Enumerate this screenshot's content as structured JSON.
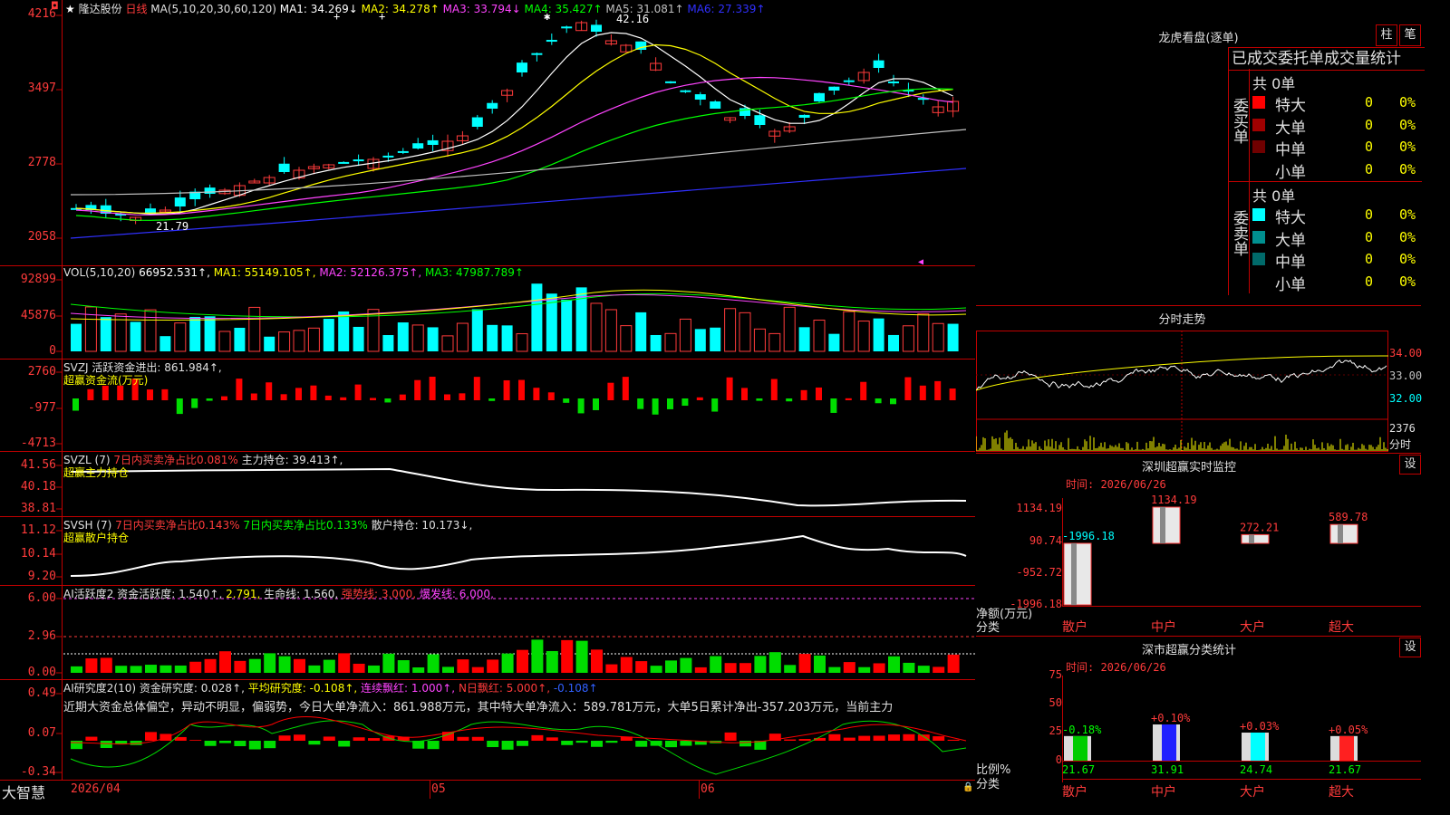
{
  "stock": {
    "star": "★",
    "name": "隆达股份",
    "period": "日线"
  },
  "ma_legend": {
    "params": "MA(5,10,20,30,60,120)",
    "items": [
      {
        "label": "MA1: 34.269↓",
        "color": "#ffffff"
      },
      {
        "label": "MA2: 34.278↑",
        "color": "#ffff00"
      },
      {
        "label": "MA3: 33.794↓",
        "color": "#ff44ff"
      },
      {
        "label": "MA4: 35.427↑",
        "color": "#00ff00"
      },
      {
        "label": "MA5: 31.081↑",
        "color": "#c0c0c0"
      },
      {
        "label": "MA6: 27.339↑",
        "color": "#3030ff"
      }
    ]
  },
  "price_axis": [
    "4216",
    "3497",
    "2778",
    "2058"
  ],
  "price_marks": {
    "high": "42.16",
    "low": "21.79"
  },
  "vol": {
    "axis": [
      "92899",
      "45876",
      "0"
    ],
    "title": "VOL(5,10,20)",
    "items": [
      {
        "label": "66952.531↑,",
        "color": "#ffffff"
      },
      {
        "label": "MA1: 55149.105↑,",
        "color": "#ffff00"
      },
      {
        "label": "MA2: 52126.375↑,",
        "color": "#ff44ff"
      },
      {
        "label": "MA3: 47987.789↑",
        "color": "#00ff00"
      }
    ]
  },
  "svzj": {
    "axis": [
      "2760",
      "-977",
      "-4713"
    ],
    "line1": "SVZJ  活跃资金进出: 861.984↑,",
    "line2": "超赢资金流(万元)"
  },
  "svzl": {
    "axis": [
      "41.56",
      "40.18",
      "38.81"
    ],
    "title": "SVZL (7)",
    "red": "7日内买卖净占比0.081%",
    "white": "主力持仓: 39.413↑,",
    "line2": "超赢主力持仓"
  },
  "svsh": {
    "axis": [
      "11.12",
      "10.14",
      "9.20"
    ],
    "title": "SVSH (7)",
    "red": "7日内买卖净占比0.143%",
    "green": "7日内买卖净占比0.133%",
    "white": "散户持仓: 10.173↓,",
    "line2": "超赢散户持仓"
  },
  "ai1": {
    "axis": [
      "6.00",
      "2.96",
      "0.00"
    ],
    "title": "AI活跃度2",
    "white": "资金活跃度: 1.540↑,",
    "yellow": "2.791,",
    "white2": "生命线: 1.560,",
    "red": "强势线: 3.000,",
    "magenta": "爆发线: 6.000,"
  },
  "ai2": {
    "axis": [
      "0.49",
      "0.07",
      "-0.34"
    ],
    "title": "AI研究度2(10)",
    "white": "资金研究度: 0.028↑,",
    "yellow": "平均研究度: -0.108↑,",
    "magenta": "连续飘红: 1.000↑,",
    "red": "N日飘红: 5.000↑,",
    "blue": "-0.108↑",
    "comment": "近期大资金总体偏空，异动不明显，偏弱势，今日大单净流入：861.988万元，其中特大单净流入：589.781万元，大单5日累计净出-357.203万元，当前主力"
  },
  "dates": {
    "brand": "大智慧",
    "d1": "2026/04",
    "d2": "05",
    "d3": "06"
  },
  "longhu": {
    "title": "龙虎看盘(逐单)",
    "btn1": "柱",
    "btn2": "笔",
    "tabs": "已成交委托单成交量统计",
    "buy": {
      "side": "委买单",
      "count": "共 0单",
      "rows": [
        {
          "name": "特大",
          "qty": "0",
          "pct": "0%",
          "color": "#ff0000"
        },
        {
          "name": "大单",
          "qty": "0",
          "pct": "0%",
          "color": "#a00000"
        },
        {
          "name": "中单",
          "qty": "0",
          "pct": "0%",
          "color": "#700000"
        },
        {
          "name": "小单",
          "qty": "0",
          "pct": "0%",
          "color": ""
        }
      ]
    },
    "sell": {
      "side": "委卖单",
      "count": "共 0单",
      "rows": [
        {
          "name": "特大",
          "qty": "0",
          "pct": "0%",
          "color": "#00ffff"
        },
        {
          "name": "大单",
          "qty": "0",
          "pct": "0%",
          "color": "#009090"
        },
        {
          "name": "中单",
          "qty": "0",
          "pct": "0%",
          "color": "#006a6a"
        },
        {
          "name": "小单",
          "qty": "0",
          "pct": "0%",
          "color": ""
        }
      ]
    }
  },
  "intraday": {
    "title": "分时走势",
    "axis": [
      "34.00",
      "33.00",
      "32.00"
    ],
    "vol_axis": [
      "2376",
      "分时"
    ]
  },
  "monitor": {
    "title": "深圳超赢实时监控",
    "settings": "设",
    "time": "时间: 2026/06/26",
    "axis": [
      "1134.19",
      "90.74",
      "-952.72",
      "-1996.18"
    ],
    "ylabel1": "净额(万元)",
    "ylabel2": "分类",
    "bars": [
      {
        "cat": "散户",
        "value": -1996.18,
        "label": "-1996.18",
        "lcolor": "#00ffff"
      },
      {
        "cat": "中户",
        "value": 1134.19,
        "label": "1134.19",
        "lcolor": "#ff3b3b"
      },
      {
        "cat": "大户",
        "value": 272.21,
        "label": "272.21",
        "lcolor": "#ff3b3b"
      },
      {
        "cat": "超大",
        "value": 589.78,
        "label": "589.78",
        "lcolor": "#ff3b3b"
      }
    ]
  },
  "classify": {
    "title": "深市超赢分类统计",
    "settings": "设",
    "time": "时间: 2026/06/26",
    "axis": [
      "75",
      "50",
      "25",
      "0"
    ],
    "ylabel1": "比例%",
    "ylabel2": "分类",
    "bars": [
      {
        "cat": "散户",
        "value": 21.67,
        "label": "21.67",
        "delta": "-0.18%",
        "dcolor": "#00ff00",
        "color": "#00cc00"
      },
      {
        "cat": "中户",
        "value": 31.91,
        "label": "31.91",
        "delta": "+0.10%",
        "dcolor": "#ff3b3b",
        "color": "#2020ff"
      },
      {
        "cat": "大户",
        "value": 24.74,
        "label": "24.74",
        "delta": "+0.03%",
        "dcolor": "#ff3b3b",
        "color": "#00ffff"
      },
      {
        "cat": "超大",
        "value": 21.67,
        "label": "21.67",
        "delta": "+0.05%",
        "dcolor": "#ff3b3b",
        "color": "#ff2020"
      }
    ]
  }
}
